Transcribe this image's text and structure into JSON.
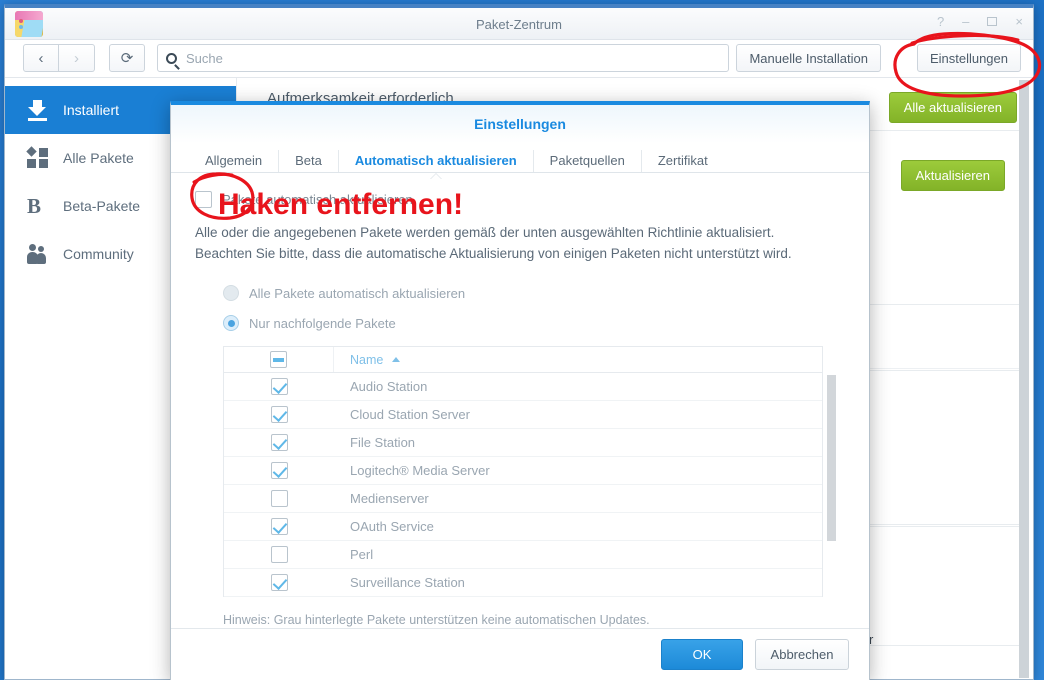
{
  "window": {
    "title": "Paket-Zentrum",
    "app_icon": "package-box-icon",
    "controls": {
      "help": "?",
      "minimize": "–",
      "maximize": "□",
      "close": "×"
    }
  },
  "toolbar": {
    "back_icon": "chevron-left-icon",
    "back_label": "‹",
    "forward_label": "›",
    "reload_label": "⟳",
    "search_placeholder": "Suche",
    "search_value": "",
    "manual_install_label": "Manuelle Installation",
    "settings_label": "Einstellungen"
  },
  "sidebar": {
    "items": [
      {
        "label": "Installiert",
        "icon": "download-icon",
        "active": true
      },
      {
        "label": "Alle Pakete",
        "icon": "grid-squares-icon",
        "active": false
      },
      {
        "label": "Beta-Pakete",
        "icon": "beta-b-icon",
        "active": false
      },
      {
        "label": "Community",
        "icon": "people-icon",
        "active": false
      }
    ]
  },
  "content": {
    "section_title": "Aufmerksamkeit erforderlich",
    "update_all_label": "Alle aktualisieren",
    "update_label": "Aktualisieren",
    "stray_char": "r"
  },
  "modal": {
    "title": "Einstellungen",
    "tabs": [
      {
        "label": "Allgemein",
        "active": false
      },
      {
        "label": "Beta",
        "active": false
      },
      {
        "label": "Automatisch aktualisieren",
        "active": true
      },
      {
        "label": "Paketquellen",
        "active": false
      },
      {
        "label": "Zertifikat",
        "active": false
      }
    ],
    "auto_update": {
      "checkbox_label": "Pakete automatisch aktualisieren",
      "checkbox_checked": false,
      "description": "Alle oder die angegebenen Pakete werden gemäß der unten ausgewählten Richtlinie aktualisiert. Beachten Sie bitte, dass die automatische Aktualisierung von einigen Paketen nicht unterstützt wird.",
      "radios": [
        {
          "label": "Alle Pakete automatisch aktualisieren",
          "selected": false
        },
        {
          "label": "Nur nachfolgende Pakete",
          "selected": true
        }
      ],
      "grid": {
        "header_checkbox_state": "indeterminate",
        "column_name": "Name",
        "sort_direction": "asc",
        "rows": [
          {
            "name": "Audio Station",
            "checked": true
          },
          {
            "name": "Cloud Station Server",
            "checked": true
          },
          {
            "name": "File Station",
            "checked": true
          },
          {
            "name": "Logitech® Media Server",
            "checked": true
          },
          {
            "name": "Medienserver",
            "checked": false
          },
          {
            "name": "OAuth Service",
            "checked": true
          },
          {
            "name": "Perl",
            "checked": false
          },
          {
            "name": "Surveillance Station",
            "checked": true
          }
        ]
      },
      "hint": "Hinweis: Grau hinterlegte Pakete unterstützen keine automatischen Updates."
    },
    "ok_label": "OK",
    "cancel_label": "Abbrechen"
  },
  "annotations": {
    "color": "#e8141c",
    "note_text": "Haken entfernen!",
    "circles": [
      "settings-button-circle",
      "checkbox-circle"
    ]
  },
  "colors": {
    "accent_blue": "#1a8ae0",
    "sidebar_active": "#1a7fd4",
    "green_button": "#8cbf2f",
    "annotation_red": "#e8141c",
    "desktop": "#2a7fd4"
  }
}
